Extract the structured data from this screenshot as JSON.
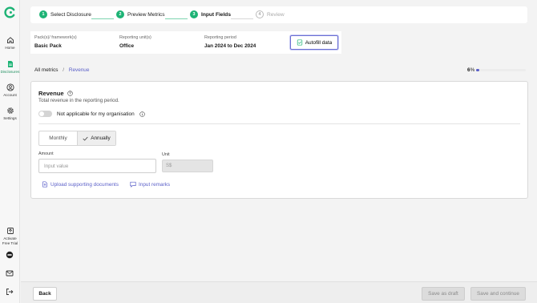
{
  "sidebar": {
    "items": [
      {
        "label": "Home",
        "icon": "home-icon"
      },
      {
        "label": "Disclosures",
        "icon": "document-icon"
      },
      {
        "label": "Account",
        "icon": "account-icon"
      },
      {
        "label": "Settings",
        "icon": "gear-icon"
      }
    ],
    "activate_label_1": "Activate",
    "activate_label_2": "Free Trial"
  },
  "stepper": {
    "steps": [
      {
        "num": "1",
        "label": "Select Disclosure",
        "state": "done"
      },
      {
        "num": "2",
        "label": "Preview Metrics",
        "state": "done"
      },
      {
        "num": "3",
        "label": "Input Fields",
        "state": "current"
      },
      {
        "num": "4",
        "label": "Review",
        "state": "pending"
      }
    ]
  },
  "info": {
    "pack_label": "Pack(s)/ framework(s)",
    "pack_value": "Basic Pack",
    "unit_label": "Reporting unit(s)",
    "unit_value": "Office",
    "period_label": "Reporting period",
    "period_value": "Jan 2024 to Dec 2024",
    "autofill_label": "Autofill data"
  },
  "breadcrumb": {
    "root": "All metrics",
    "separator": "/",
    "current": "Revenue"
  },
  "progress": {
    "value": "6",
    "unit": "%",
    "fraction": 0.06
  },
  "metric": {
    "title": "Revenue",
    "description": "Total revenue in the reporting period.",
    "toggle_label": "Not applicable for my organisation",
    "frequency_options": [
      "Monthly",
      "Annually"
    ],
    "selected_frequency": "Annually",
    "amount_label": "Amount",
    "amount_placeholder": "Input value",
    "unit_label": "Unit",
    "unit_value": "S$",
    "upload_label": "Upload supporting documents",
    "remarks_label": "Input remarks"
  },
  "footer": {
    "back_label": "Back",
    "draft_label": "Save as draft",
    "continue_label": "Save and continue"
  },
  "colors": {
    "accent": "#5a5fc8",
    "brand_green": "#1db375",
    "disabled_bg": "#dcdcdc"
  }
}
